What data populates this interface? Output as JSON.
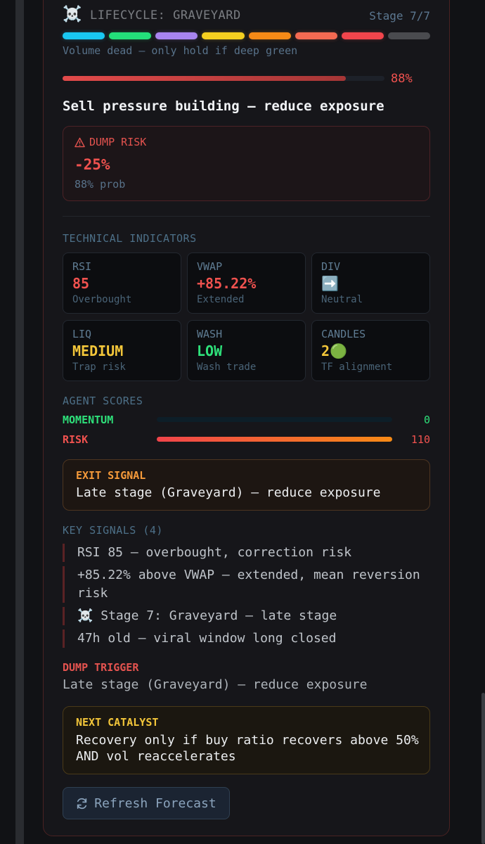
{
  "lifecycle": {
    "icon": "☠️",
    "title": "LIFECYCLE: GRAVEYARD",
    "stage_text": "Stage 7/7",
    "stage_colors": [
      "#19c8f2",
      "#23e07a",
      "#a884f0",
      "#f5d020",
      "#f78a16",
      "#f46a52",
      "#f2454c",
      "#4a4b4f"
    ],
    "subtitle": "Volume dead — only hold if deep green",
    "progress_fraction": 0.88,
    "progress_label": "88%",
    "headline": "Sell pressure building — reduce exposure"
  },
  "dump_risk": {
    "icon": "warning-triangle-icon",
    "label": "DUMP RISK",
    "value": "-25%",
    "probability": "88% prob"
  },
  "technical": {
    "label": "TECHNICAL INDICATORS",
    "items": [
      {
        "name": "RSI",
        "value": "85",
        "note": "Overbought",
        "color": "#f0524f"
      },
      {
        "name": "VWAP",
        "value": "+85.22%",
        "note": "Extended",
        "color": "#f0524f"
      },
      {
        "name": "DIV",
        "value": "➡️",
        "note": "Neutral",
        "color": "#5fa8e8"
      },
      {
        "name": "LIQ",
        "value": "MEDIUM",
        "note": "Trap risk",
        "color": "#f3c63a"
      },
      {
        "name": "WASH",
        "value": "LOW",
        "note": "Wash trade",
        "color": "#2ee07a"
      },
      {
        "name": "CANDLES",
        "value": "2🟢",
        "note": "TF alignment",
        "color": "#f3c63a"
      }
    ]
  },
  "agent_scores": {
    "label": "AGENT SCORES",
    "items": [
      {
        "name": "MOMENTUM",
        "value": "0",
        "fraction": 0.0,
        "color": "#2ee07a"
      },
      {
        "name": "RISK",
        "value": "110",
        "fraction": 1.0,
        "color": "#f0524f"
      }
    ]
  },
  "exit_signal": {
    "label": "EXIT SIGNAL",
    "text": "Late stage (Graveyard) — reduce exposure"
  },
  "key_signals": {
    "label": "KEY SIGNALS (4)",
    "items": [
      "RSI 85 — overbought, correction risk",
      "+85.22% above VWAP — extended, mean reversion risk",
      "☠️ Stage 7: Graveyard — late stage",
      "47h old — viral window long closed"
    ]
  },
  "dump_trigger": {
    "label": "DUMP TRIGGER",
    "text": "Late stage (Graveyard) — reduce exposure"
  },
  "next_catalyst": {
    "label": "NEXT CATALYST",
    "text": "Recovery only if buy ratio recovers above 50% AND vol reaccelerates"
  },
  "refresh_button": {
    "icon": "refresh-icon",
    "label": "Refresh Forecast"
  }
}
